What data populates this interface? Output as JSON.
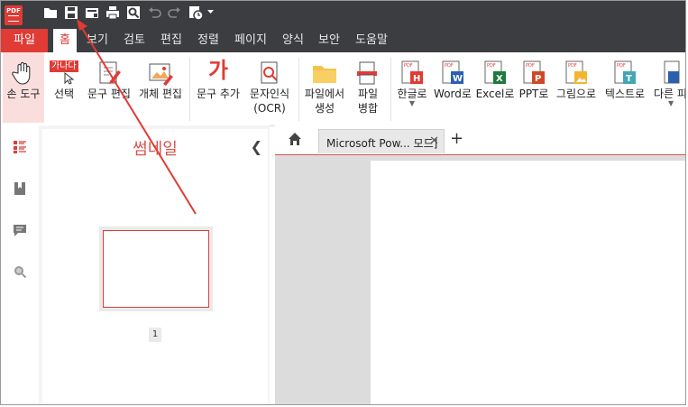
{
  "app": {
    "logo_text": "PDF"
  },
  "quick_access": [
    {
      "name": "open-folder-icon"
    },
    {
      "name": "save-icon"
    },
    {
      "name": "scan-icon"
    },
    {
      "name": "print-icon"
    },
    {
      "name": "print-preview-icon"
    },
    {
      "name": "undo-icon"
    },
    {
      "name": "redo-icon"
    },
    {
      "name": "history-icon"
    }
  ],
  "menu": {
    "file": "파일",
    "home": "홈",
    "view": "보기",
    "review": "검토",
    "edit": "편집",
    "arrange": "정렬",
    "page": "페이지",
    "form": "양식",
    "security": "보안",
    "help": "도움말"
  },
  "ribbon": {
    "hand_tool": "손 도구",
    "select": "선택",
    "select_badge": "가나다",
    "text_edit": "문구 편집",
    "object_edit": "개체 편집",
    "add_text": "문구 추가",
    "add_text_glyph": "가",
    "ocr_line1": "문자인식",
    "ocr_line2": "(OCR)",
    "create_line1": "파일에서",
    "create_line2": "생성",
    "merge_line1": "파일",
    "merge_line2": "병합",
    "to_hangul": "한글로",
    "to_word": "Word로",
    "to_excel": "Excel로",
    "to_ppt": "PPT로",
    "to_image": "그림으로",
    "to_text": "텍스트로",
    "to_other": "다른 피",
    "icon_letters": {
      "hangul": "H",
      "word": "W",
      "excel": "X",
      "ppt": "P",
      "text": "T"
    },
    "badge_pdf": "PDF"
  },
  "panel": {
    "title": "썸네일",
    "page_number": "1"
  },
  "tabs": {
    "doc_title": "Microsoft Pow... 모드]",
    "close": "✕",
    "new": "+"
  },
  "colors": {
    "accent": "#e03b35",
    "titlebar": "#3b3d40"
  }
}
